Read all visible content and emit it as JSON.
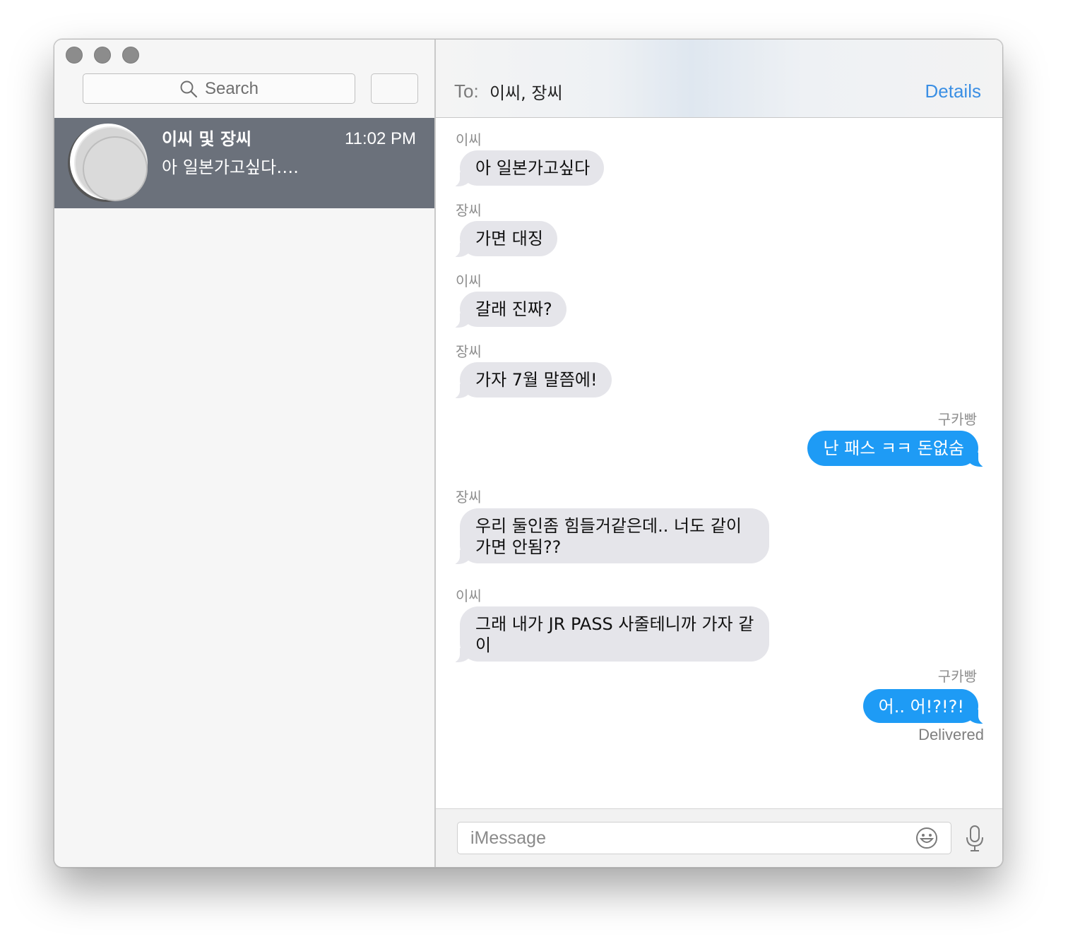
{
  "sidebar": {
    "search_placeholder": "Search",
    "conversation": {
      "name": "이씨 및 장씨",
      "time": "11:02 PM",
      "preview": "아 일본가고싶다…."
    }
  },
  "chat": {
    "to_label": "To:",
    "to_value": "이씨, 장씨",
    "details_label": "Details",
    "input_placeholder": "iMessage",
    "delivered_label": "Delivered",
    "messages": [
      {
        "sender": "이씨",
        "text": "아 일본가고싶다",
        "direction": "incoming"
      },
      {
        "sender": "장씨",
        "text": "가면 대징",
        "direction": "incoming"
      },
      {
        "sender": "이씨",
        "text": "갈래 진짜?",
        "direction": "incoming"
      },
      {
        "sender": "장씨",
        "text": "가자 7월 말쯤에!",
        "direction": "incoming"
      },
      {
        "sender": "구카빵",
        "text": "난 패스 ㅋㅋ 돈없숨",
        "direction": "outgoing"
      },
      {
        "sender": "장씨",
        "text": "우리 둘인좀 힘들거같은데.. 너도 같이가면 안됨??",
        "direction": "incoming"
      },
      {
        "sender": "이씨",
        "text": "그래 내가 JR PASS 사줄테니까 가자 같이",
        "direction": "incoming"
      },
      {
        "sender": "구카빵",
        "text": "어.. 어!?!?!",
        "direction": "outgoing"
      }
    ]
  },
  "colors": {
    "outgoing_bubble": "#1e9bf5",
    "incoming_bubble": "#e5e5ea",
    "selected_row": "#6b717b",
    "link": "#3b8fe4"
  },
  "icons": [
    "search-icon",
    "emoji-icon",
    "microphone-icon",
    "close-icon",
    "minimize-icon",
    "zoom-icon",
    "compose-icon"
  ]
}
